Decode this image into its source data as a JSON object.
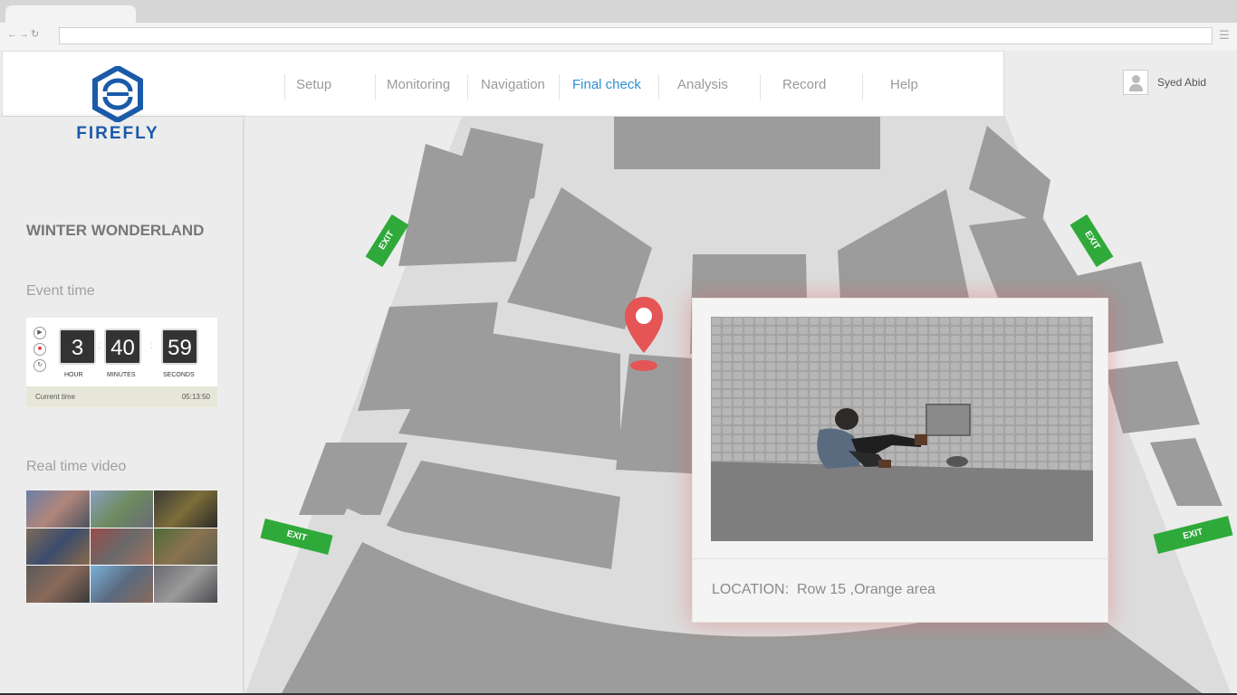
{
  "app": {
    "brand": "FIREFLY"
  },
  "nav": {
    "items": [
      "Setup",
      "Monitoring",
      "Navigation",
      "Final check",
      "Analysis",
      "Record",
      "Help"
    ],
    "active": "Final check"
  },
  "user": {
    "name": "Syed Abid"
  },
  "sidebar": {
    "event_name": "WINTER WONDERLAND",
    "event_time_label": "Event time",
    "timer": {
      "hours": "3",
      "minutes": "40",
      "seconds": "59",
      "hour_label": "HOUR",
      "minutes_label": "MINUTES",
      "seconds_label": "SECONDS",
      "current_time_label": "Current time",
      "current_time_value": "05:13:50"
    },
    "real_time_video_label": "Real time video"
  },
  "map": {
    "exits": [
      "EXIT",
      "EXIT",
      "EXIT",
      "EXIT"
    ]
  },
  "popup": {
    "location_label": "LOCATION:",
    "location_value": "Row 15 ,Orange area"
  },
  "colors": {
    "accent": "#2e8fd0",
    "brand": "#1a5aa9",
    "exit": "#2faa3a",
    "pin": "#e55555"
  }
}
